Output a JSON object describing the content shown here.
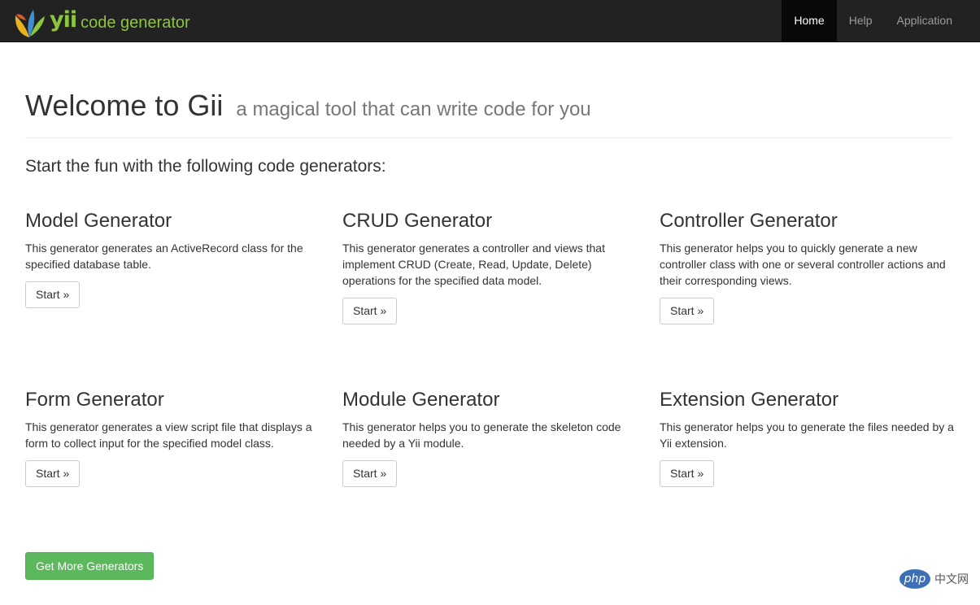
{
  "navbar": {
    "brand": {
      "yii": "yii",
      "text": "code generator"
    },
    "items": [
      {
        "label": "Home",
        "active": true
      },
      {
        "label": "Help",
        "active": false
      },
      {
        "label": "Application",
        "active": false
      }
    ]
  },
  "header": {
    "title": "Welcome to Gii",
    "subtitle": "a magical tool that can write code for you"
  },
  "lead": "Start the fun with the following code generators:",
  "generators": [
    {
      "name": "Model Generator",
      "description": "This generator generates an ActiveRecord class for the specified database table.",
      "button": "Start »"
    },
    {
      "name": "CRUD Generator",
      "description": "This generator generates a controller and views that implement CRUD (Create, Read, Update, Delete) operations for the specified data model.",
      "button": "Start »"
    },
    {
      "name": "Controller Generator",
      "description": "This generator helps you to quickly generate a new controller class with one or several controller actions and their corresponding views.",
      "button": "Start »"
    },
    {
      "name": "Form Generator",
      "description": "This generator generates a view script file that displays a form to collect input for the specified model class.",
      "button": "Start »"
    },
    {
      "name": "Module Generator",
      "description": "This generator helps you to generate the skeleton code needed by a Yii module.",
      "button": "Start »"
    },
    {
      "name": "Extension Generator",
      "description": "This generator helps you to generate the files needed by a Yii extension.",
      "button": "Start »"
    }
  ],
  "more_button": "Get More Generators",
  "watermark": {
    "badge": "php",
    "text": "中文网"
  },
  "colors": {
    "navbar": "#222222",
    "brand_green": "#8cc63f",
    "success": "#5cb85c"
  }
}
